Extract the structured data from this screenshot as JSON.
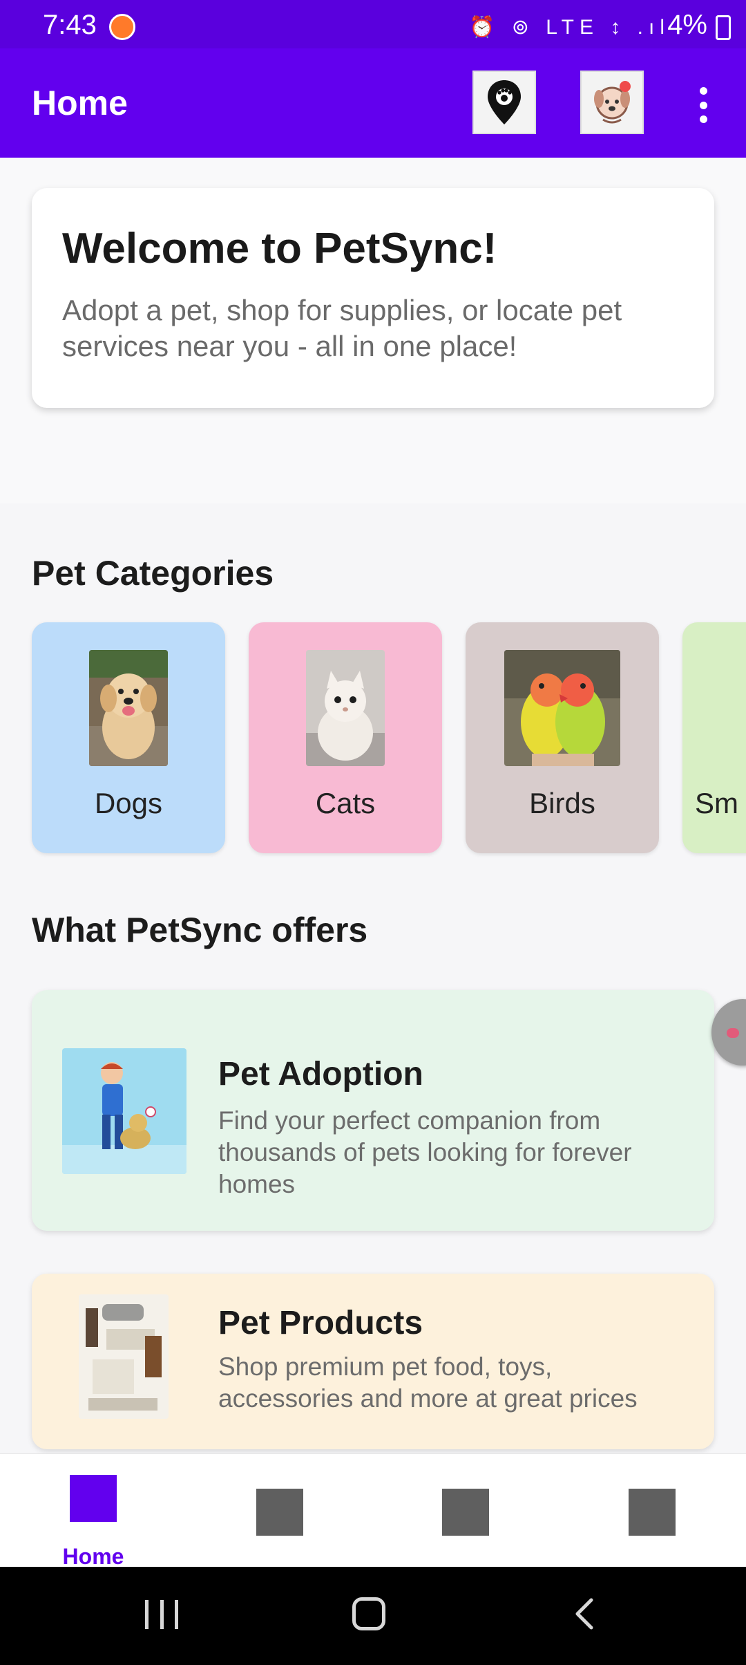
{
  "status_bar": {
    "time": "7:43",
    "icons_text": "⏰ ⊚ LTE ↕ .ıl",
    "battery": "4%"
  },
  "app_bar": {
    "title": "Home",
    "icons": [
      "location-pin-icon",
      "vet-icon",
      "overflow-menu-icon"
    ]
  },
  "welcome": {
    "title": "Welcome to PetSync!",
    "text": "Adopt a pet, shop for supplies, or locate pet services near you - all in one place!"
  },
  "categories": {
    "title": "Pet Categories",
    "items": [
      {
        "label": "Dogs",
        "color": "#bcdcfa"
      },
      {
        "label": "Cats",
        "color": "#f8bad3"
      },
      {
        "label": "Birds",
        "color": "#d8cccc"
      },
      {
        "label": "Sm",
        "color": "#d8efc4"
      }
    ]
  },
  "offers": {
    "title": "What PetSync offers",
    "items": [
      {
        "title": "Pet Adoption",
        "description": "Find your perfect companion from thousands of pets looking for forever homes",
        "color": "#e6f5ea"
      },
      {
        "title": "Pet Products",
        "description": "Shop premium pet food, toys, accessories and more at great prices",
        "color": "#fdf1dc"
      }
    ]
  },
  "bottom_nav": {
    "items": [
      {
        "label": "Home",
        "active": true
      },
      {
        "label": "",
        "active": false
      },
      {
        "label": "",
        "active": false
      },
      {
        "label": "",
        "active": false
      }
    ],
    "active_color": "#6200ee",
    "inactive_color": "#5f5f5f"
  },
  "colors": {
    "primary": "#6200ee",
    "status_bar": "#5a00dd"
  }
}
